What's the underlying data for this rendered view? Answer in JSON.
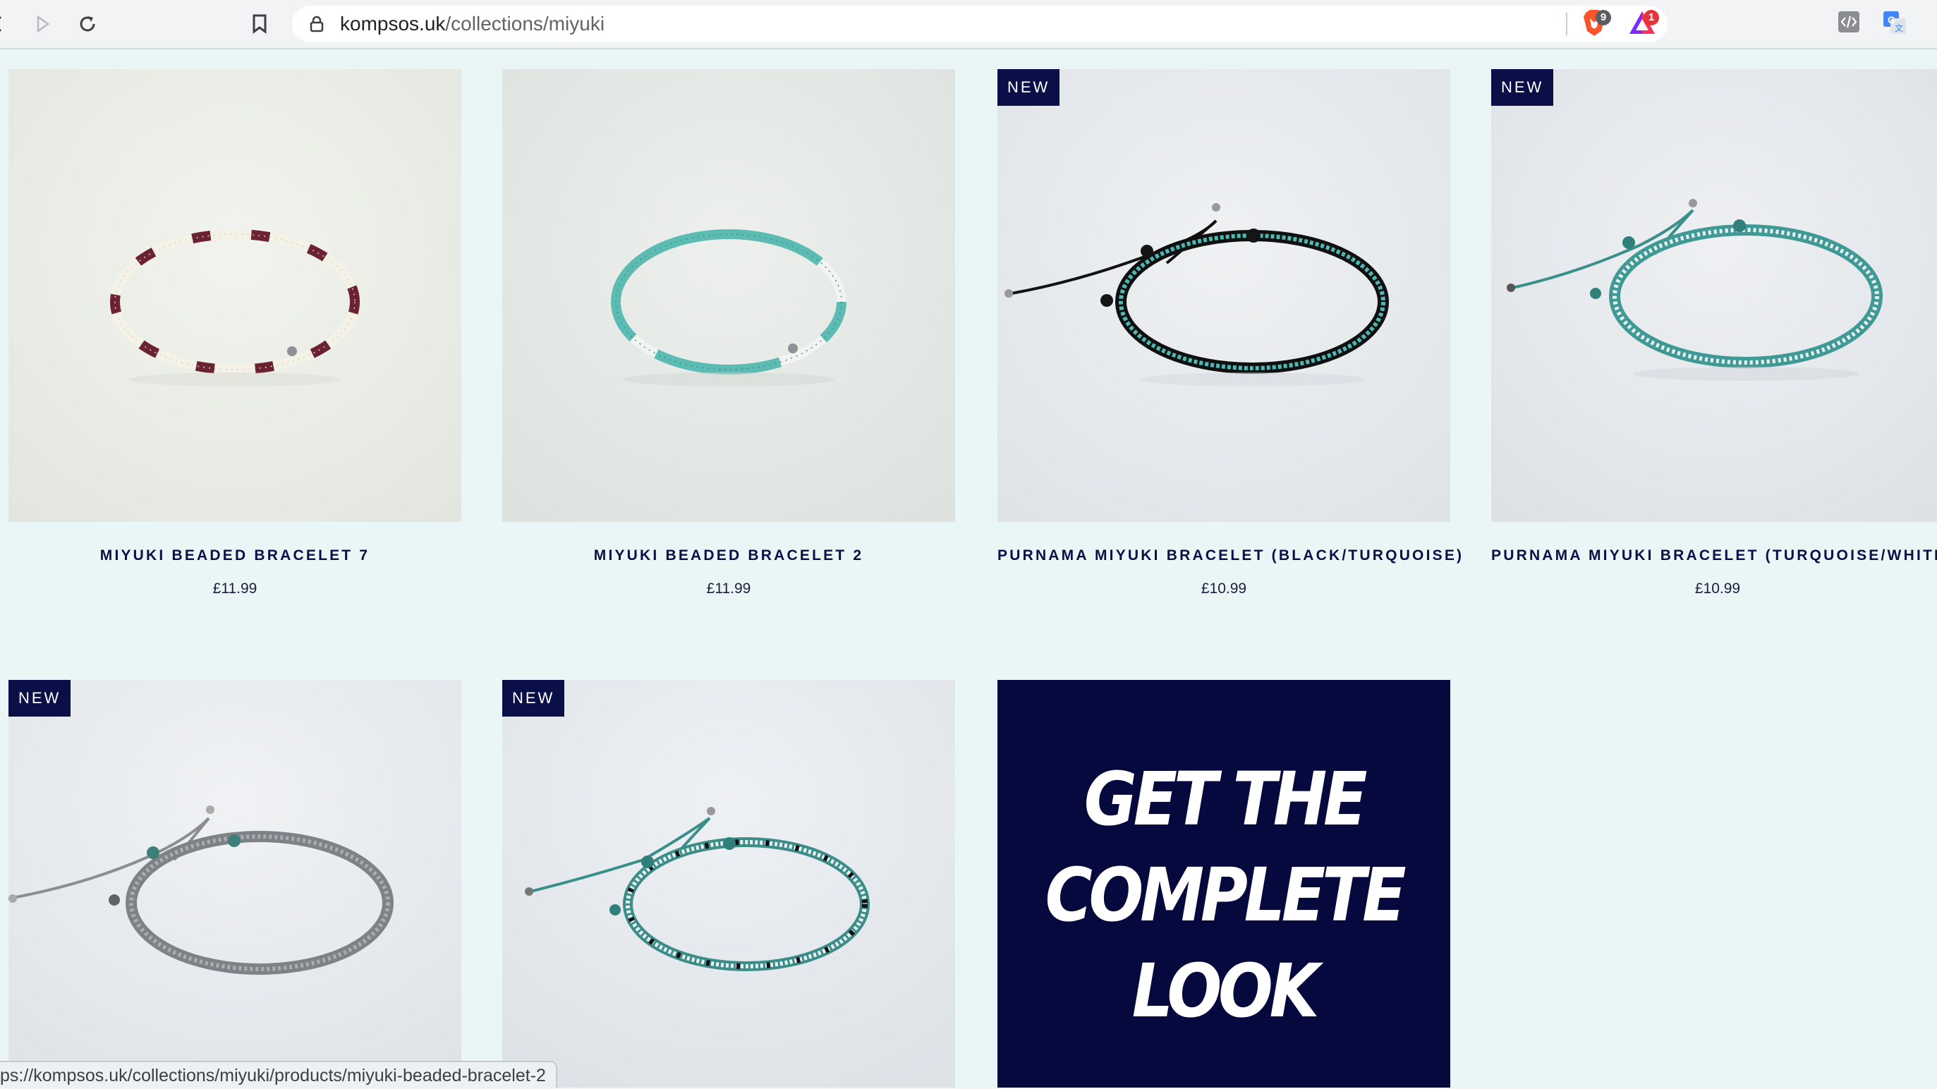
{
  "browser": {
    "url_domain": "kompsos.uk",
    "url_path": "/collections/miyuki",
    "brave_shield_count": "9",
    "rewards_count": "1",
    "status_bar_url": "ps://kompsos.uk/collections/miyuki/products/miyuki-beaded-bracelet-2"
  },
  "products": [
    {
      "title": "MIYUKI BEADED BRACELET 7",
      "price": "£11.99",
      "badge": ""
    },
    {
      "title": "MIYUKI BEADED BRACELET 2",
      "price": "£11.99",
      "badge": ""
    },
    {
      "title": "PURNAMA MIYUKI BRACELET (BLACK/TURQUOISE)",
      "price": "£10.99",
      "badge": "NEW"
    },
    {
      "title": "PURNAMA MIYUKI BRACELET (TURQUOISE/WHITE)",
      "price": "£10.99",
      "badge": "NEW"
    },
    {
      "title": "",
      "price": "",
      "badge": "NEW"
    },
    {
      "title": "",
      "price": "",
      "badge": "NEW"
    }
  ],
  "promo": {
    "line1": "GET THE",
    "line2": "COMPLETE",
    "line3": "LOOK"
  },
  "colors": {
    "page_background": "#eaf6f5",
    "brand_navy": "#0b0f47",
    "promo_background": "#06093d"
  }
}
